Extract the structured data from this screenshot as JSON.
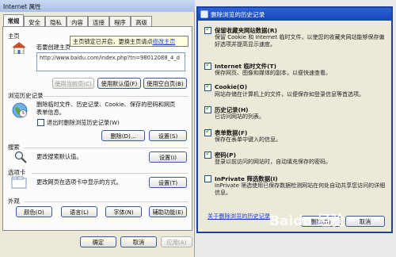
{
  "props": {
    "title": "Internet 属性",
    "tabs": [
      "常规",
      "安全",
      "隐私",
      "内容",
      "连接",
      "程序",
      "高级"
    ],
    "homepage": {
      "heading": "主页",
      "desc": "若要创建主页",
      "tooltip": "主页锁定已开启，更换主页请点",
      "tooltip_link": "修改主页",
      "url": "http://www.baidu.com/index.php?tn=98012088_4_d",
      "btn_current": "使用当前页(C)",
      "btn_default": "使用默认值(F)",
      "btn_blank": "使用空白页(B)"
    },
    "history": {
      "heading": "浏览历史记录",
      "desc1": "删除临时文件、历史记录、Cookie、保存的密码和网页",
      "desc2": "表单信息。",
      "exit_delete": "退出时删除浏览历史记录(W)",
      "btn_delete": "删除(D)...",
      "btn_settings": "设置(S)"
    },
    "search": {
      "heading": "搜索",
      "desc": "更改搜索默认值。",
      "btn_settings": "设置(I)"
    },
    "tabsec": {
      "heading": "选项卡",
      "desc": "更改网页在选项卡中显示的方式。",
      "btn_settings": "设置(T)"
    },
    "appearance": {
      "heading": "外观",
      "btn_colors": "颜色(O)",
      "btn_languages": "语言(L)",
      "btn_fonts": "字体(N)",
      "btn_access": "辅助功能(E)"
    },
    "btn_ok": "确定",
    "btn_cancel": "取消",
    "btn_apply": "应用(A)"
  },
  "delete_history": {
    "title": "删除浏览的历史记录",
    "items": [
      {
        "title": "保留收藏夹网站数据(R)",
        "desc": [
          "保留 Cookie 和 Internet 临时文件，以使您的收藏夹网站能够保存偏好选项并提高显示速度。"
        ],
        "checked": true
      },
      {
        "title": "Internet 临时文件(T)",
        "desc": [
          "保存网页、图像和媒体的副本，以便快速查看。"
        ],
        "checked": true
      },
      {
        "title": "Cookie(O)",
        "desc": [
          "网站存储在计算机上的文件，以便保存如登录信息等首选项。"
        ],
        "checked": true
      },
      {
        "title": "历史记录(H)",
        "desc": [
          "已访问网站的列表。"
        ],
        "checked": true
      },
      {
        "title": "表单数据(F)",
        "desc": [
          "保存在表单中键入的信息。"
        ],
        "checked": true
      },
      {
        "title": "密码(P)",
        "desc": [
          "登录以前访问的网站时，自动填充保存的密码。"
        ],
        "checked": true
      },
      {
        "title": "InPrivate 筛选数据(I)",
        "desc": [
          "InPrivate 筛选使用已保存数据检测网站在何处自动共享您访问的详细信息。"
        ],
        "checked": false
      }
    ],
    "link": "关于删除浏览的历史记录",
    "btn_delete": "删除(D)",
    "btn_cancel": "取消"
  },
  "watermark": "Baidu 经验"
}
